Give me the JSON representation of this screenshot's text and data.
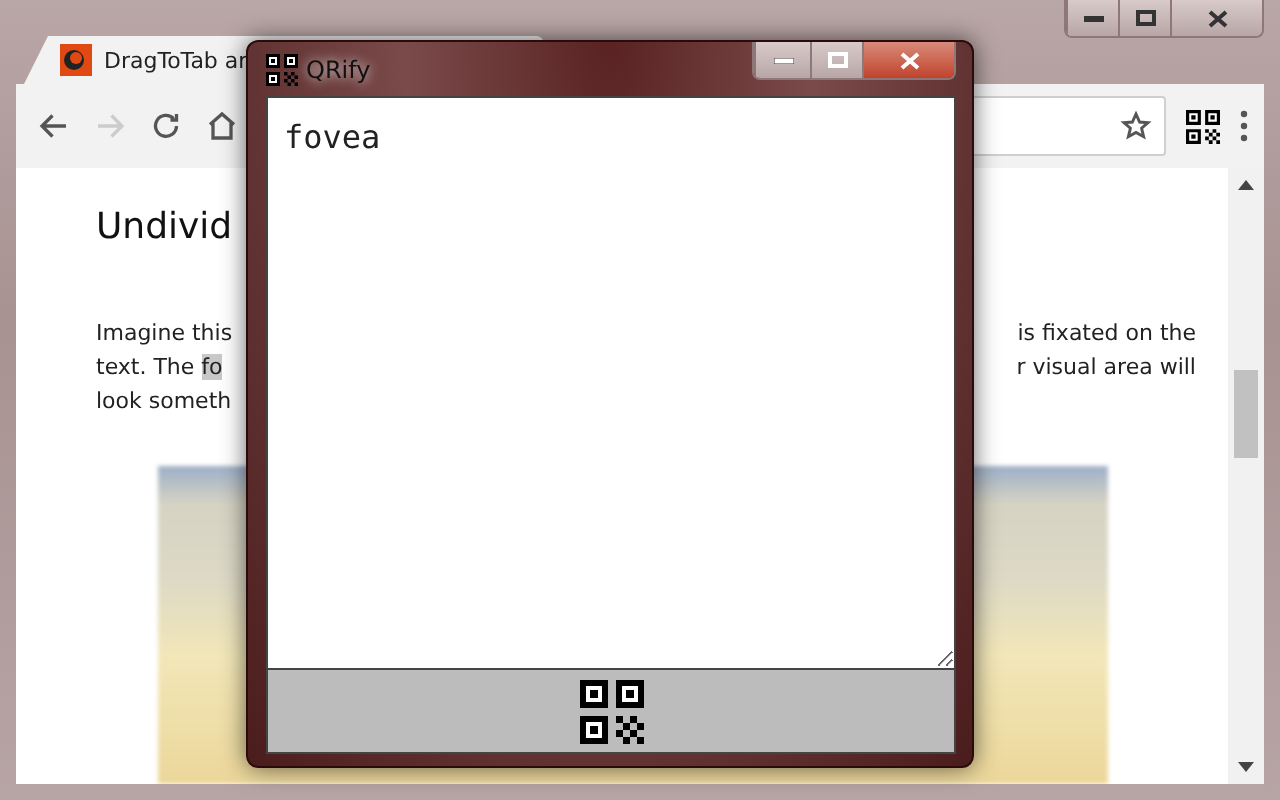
{
  "browser": {
    "tab": {
      "title": "DragToTab ar"
    },
    "page": {
      "heading": "Undivid",
      "lines": [
        {
          "left": "Imagine this",
          "right": "is fixated on the"
        },
        {
          "left": "text. The ",
          "selected_text": "fo",
          "right": "r visual area will"
        },
        {
          "left": "look someth"
        }
      ]
    }
  },
  "popup": {
    "title": "QRify",
    "text": "fovea"
  }
}
